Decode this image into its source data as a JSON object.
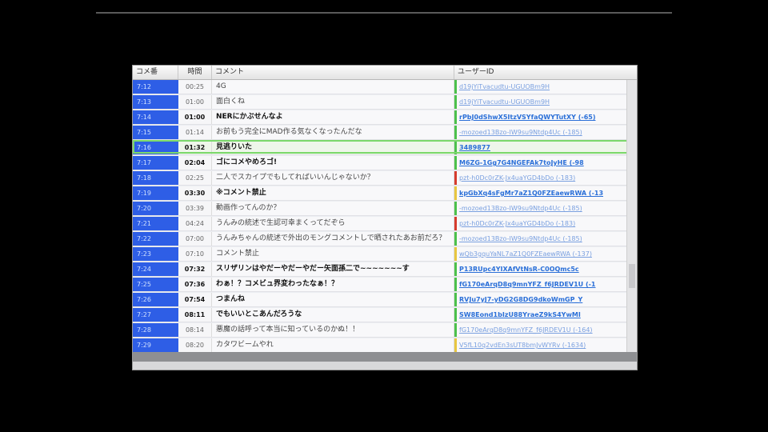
{
  "columns": {
    "no": "コメ番",
    "time": "時間",
    "comment": "コメント",
    "user": "ユーザーID"
  },
  "rows": [
    {
      "no": "7:12",
      "time": "00:25",
      "comment": "4G",
      "user": "d19jYiTvacudtu-UGUOBm9H",
      "bold": false,
      "mark": "#4cc14c"
    },
    {
      "no": "7:13",
      "time": "01:00",
      "comment": "面白くね",
      "user": "d19jYiTvacudtu-UGUOBm9H",
      "bold": false,
      "mark": "#4cc14c"
    },
    {
      "no": "7:14",
      "time": "01:00",
      "comment": "NERにかぶせんなよ",
      "user": "rPbJ0dShwX5ItzVSYfaQWYTutXY (-65)",
      "bold": true,
      "mark": "#4cc14c"
    },
    {
      "no": "7:15",
      "time": "01:14",
      "comment": "お前もう完全にMAD作る気なくなったんだな",
      "user": "-mozoed13Bzo-IW9su9Ntdp4Uc (-185)",
      "bold": false,
      "mark": "#4cc14c"
    },
    {
      "no": "7:16",
      "time": "01:32",
      "comment": "見逃りいた",
      "user": "3489877",
      "bold": true,
      "mark": "#4cc14c",
      "selected": true
    },
    {
      "no": "7:17",
      "time": "02:04",
      "comment": "ゴにコメやめろゴ!",
      "user": "M6ZG-1Gg7G4NGEFAk7toJyHE (-98",
      "bold": true,
      "mark": "#4cc14c"
    },
    {
      "no": "7:18",
      "time": "02:25",
      "comment": "二人でスカイプでもしてればいいんじゃないか？",
      "user": "pzt-h0Dc0rZK-Jx4uaYGD4bDo (-183)",
      "bold": false,
      "mark": "#d63c2e"
    },
    {
      "no": "7:19",
      "time": "03:30",
      "comment": "※コメント禁止",
      "user": "kpGbXq4sFgMr7aZ1Q0FZEaewRWA (-13",
      "bold": true,
      "mark": "#e8c640"
    },
    {
      "no": "7:20",
      "time": "03:39",
      "comment": "動画作ってんのか？",
      "user": "-mozoed13Bzo-IW9su9Ntdp4Uc (-185)",
      "bold": false,
      "mark": "#4cc14c"
    },
    {
      "no": "7:21",
      "time": "04:24",
      "comment": "うんみの統述で生認可幸まくってだぞら",
      "user": "pzt-h0Dc0rZK-Jx4uaYGD4bDo (-183)",
      "bold": false,
      "mark": "#d63c2e"
    },
    {
      "no": "7:22",
      "time": "07:00",
      "comment": "うんみちゃんの統述で外出のモングコメントしで晒されたあお前だろ？",
      "user": "-mozoed13Bzo-IW9su9Ntdp4Uc (-185)",
      "bold": false,
      "mark": "#4cc14c"
    },
    {
      "no": "7:23",
      "time": "07:10",
      "comment": "コメント禁止",
      "user": "wQb3gquYaNL7aZ1Q0FZEaewRWA (-137)",
      "bold": false,
      "mark": "#e8c640"
    },
    {
      "no": "7:24",
      "time": "07:32",
      "comment": "スリザリンはやだーやだーやだー矢面孫二で~~~~~~~す",
      "user": "P13RUpc4YIXAfVtNsR-C0OQmc5c",
      "bold": true,
      "mark": "#4cc14c"
    },
    {
      "no": "7:25",
      "time": "07:36",
      "comment": "わぁ！？コメビュ界変わったなぁ！？",
      "user": "fG170eArqD8q9mnYFZ_f6JRDEV1U (-1",
      "bold": true,
      "mark": "#4cc14c"
    },
    {
      "no": "7:26",
      "time": "07:54",
      "comment": "つまんね",
      "user": "RVJu7yJ7-yDG2G8DG9dkoWmGP_Y",
      "bold": true,
      "mark": "#4cc14c"
    },
    {
      "no": "7:27",
      "time": "08:11",
      "comment": "でもいいとこあんだろうな",
      "user": "SW8Eond1bIzU88YraeZ9kS4YwMI",
      "bold": true,
      "mark": "#4cc14c"
    },
    {
      "no": "7:28",
      "time": "08:14",
      "comment": "悪魔の話呼って本当に知っているのかぬ！！",
      "user": "fG170eArqD8q9mnYFZ_f6JRDEV1U (-164)",
      "bold": false,
      "mark": "#4cc14c"
    },
    {
      "no": "7:29",
      "time": "08:20",
      "comment": "カタワビームやれ",
      "user": "V5fL10q2vdEn3sUT8bmJvWYRv (-1634)",
      "bold": false,
      "mark": "#e8c640"
    }
  ]
}
